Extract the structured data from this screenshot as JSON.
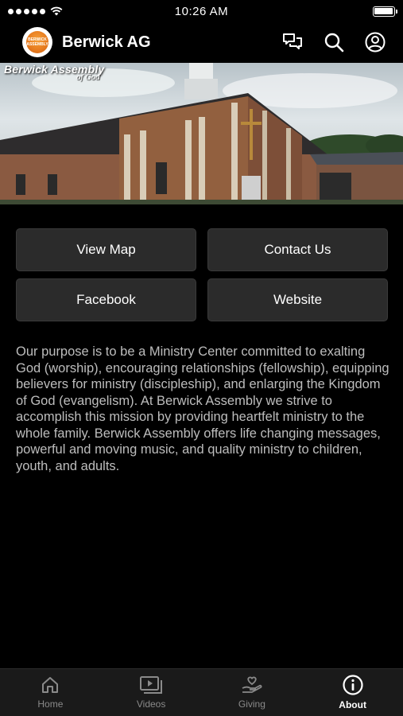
{
  "status_bar": {
    "time": "10:26 AM"
  },
  "header": {
    "title": "Berwick AG",
    "logo_text": "BERWICK ASSEMBLY"
  },
  "hero": {
    "logo_text": "Berwick Assembly",
    "logo_script": "of God"
  },
  "buttons": [
    {
      "label": "View Map"
    },
    {
      "label": "Contact Us"
    },
    {
      "label": "Facebook"
    },
    {
      "label": "Website"
    }
  ],
  "description": "Our purpose is to be a Ministry Center committed to exalting God (worship), encouraging relationships (fellowship), equipping believers for ministry (discipleship), and enlarging the Kingdom of God (evangelism). At Berwick Assembly we strive to accomplish this mission by providing heartfelt ministry to the whole family. Berwick Assembly offers life changing messages, powerful and moving music, and quality ministry to children, youth, and adults.",
  "tabs": [
    {
      "label": "Home",
      "icon": "home-icon",
      "active": false
    },
    {
      "label": "Videos",
      "icon": "videos-icon",
      "active": false
    },
    {
      "label": "Giving",
      "icon": "giving-icon",
      "active": false
    },
    {
      "label": "About",
      "icon": "info-icon",
      "active": true
    }
  ],
  "colors": {
    "background": "#000000",
    "button": "#2b2b2b",
    "tabbar": "#1a1a1a",
    "text_muted": "#bdbdbd",
    "logo_accent": "#e67a1e"
  }
}
